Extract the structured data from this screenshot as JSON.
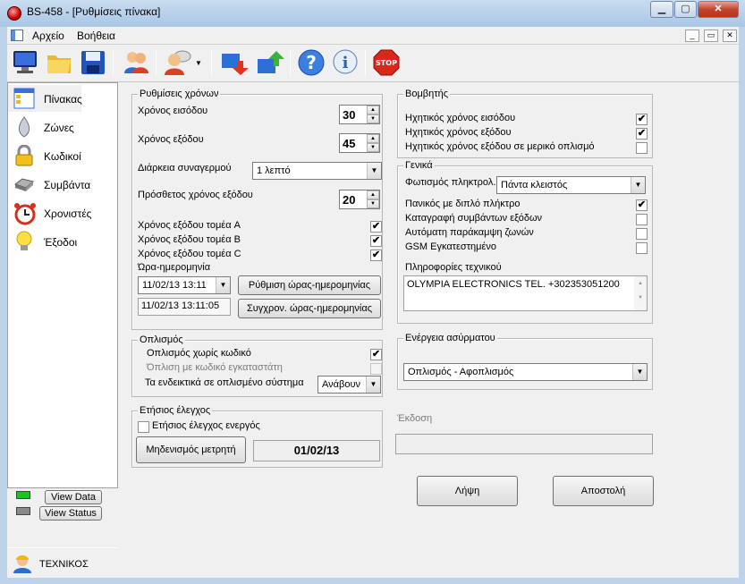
{
  "window": {
    "title": "BS-458 - [Ρυθμίσεις πίνακα]",
    "min": "▁",
    "max": "▢",
    "close": "✕"
  },
  "menu": [
    "Αρχείο",
    "Βοήθεια"
  ],
  "mdi_controls": [
    "_",
    "▭",
    "✕"
  ],
  "toolbar": {
    "icons": [
      "monitor-icon",
      "folder-open-icon",
      "save-icon",
      "users-icon",
      "user-dropdown-icon",
      "download-icon",
      "upload-icon",
      "help-icon",
      "info-icon",
      "stop-icon"
    ],
    "dropdown_arrow": "▼"
  },
  "sidebar": {
    "items": [
      {
        "label": "Πίνακας",
        "icon": "panel-icon"
      },
      {
        "label": "Ζώνες",
        "icon": "zones-icon"
      },
      {
        "label": "Κωδικοί",
        "icon": "lock-icon"
      },
      {
        "label": "Συμβάντα",
        "icon": "events-icon"
      },
      {
        "label": "Χρονιστές",
        "icon": "alarm-clock-icon"
      },
      {
        "label": "Έξοδοι",
        "icon": "lightbulb-icon"
      }
    ],
    "view_data": "View Data",
    "view_status": "View Status",
    "user": "ΤΕΧΝΙΚΟΣ"
  },
  "timers": {
    "title": "Ρυθμίσεις χρόνων",
    "entry_label": "Χρόνος εισόδου",
    "entry_value": "30",
    "exit_label": "Χρόνος εξόδου",
    "exit_value": "45",
    "alarm_duration_label": "Διάρκεια συναγερμού",
    "alarm_duration_value": "1 λεπτό",
    "extra_exit_label": "Πρόσθετος χρόνος εξόδου",
    "extra_exit_value": "20",
    "sector_a": "Χρόνος εξόδου τομέα A",
    "sector_b": "Χρόνος εξόδου τομέα B",
    "sector_c": "Χρόνος εξόδου τομέα C",
    "datetime_label": "Ώρα-ημερομηνία",
    "datetime_value": "11/02/13  13:11",
    "datetime_readout": "11/02/13  13:11:05",
    "set_datetime_btn": "Ρύθμιση ώρας-ημερομηνίας",
    "sync_datetime_btn": "Συγχρον. ώρας-ημερομηνίας",
    "check_mark": "✔",
    "up": "▲",
    "down": "▼"
  },
  "arming": {
    "title": "Οπλισμός",
    "no_code_label": "Οπλισμός χωρίς κωδικό",
    "installer_code_label": "Όπλιση με κωδικό εγκαταστάτη",
    "indicators_label": "Τα ενδεικτικά σε οπλισμένο σύστημα",
    "indicators_value": "Ανάβουν"
  },
  "annual": {
    "title": "Ετήσιος έλεγχος",
    "active_label": "Ετήσιος έλεγχος ενεργός",
    "reset_btn": "Μηδενισμός μετρητή",
    "date": "01/02/13"
  },
  "buzzer": {
    "title": "Βομβητής",
    "entry": "Ηχητικός χρόνος εισόδου",
    "exit": "Ηχητικός χρόνος εξόδου",
    "exit_partial": "Ηχητικός χρόνος εξόδου σε μερικό οπλισμό"
  },
  "general": {
    "title": "Γενικά",
    "keypad_light_label": "Φωτισμός πληκτρολ.",
    "keypad_light_value": "Πάντα κλειστός",
    "panic_label": "Πανικός με διπλό πλήκτρο",
    "log_exit_label": "Καταγραφή συμβάντων εξόδων",
    "auto_bypass_label": "Αυτόματη παράκαμψη ζωνών",
    "gsm_label": "GSM Εγκατεστημένο",
    "tech_info_label": "Πληροφορίες τεχνικού",
    "tech_info_value": "OLYMPIA ELECTRONICS   TEL. +302353051200"
  },
  "wireless": {
    "title": "Ενέργεια ασύρματου",
    "value": "Οπλισμός - Αφοπλισμός"
  },
  "version_label": "Έκδοση",
  "receive_btn": "Λήψη",
  "send_btn": "Αποστολή"
}
